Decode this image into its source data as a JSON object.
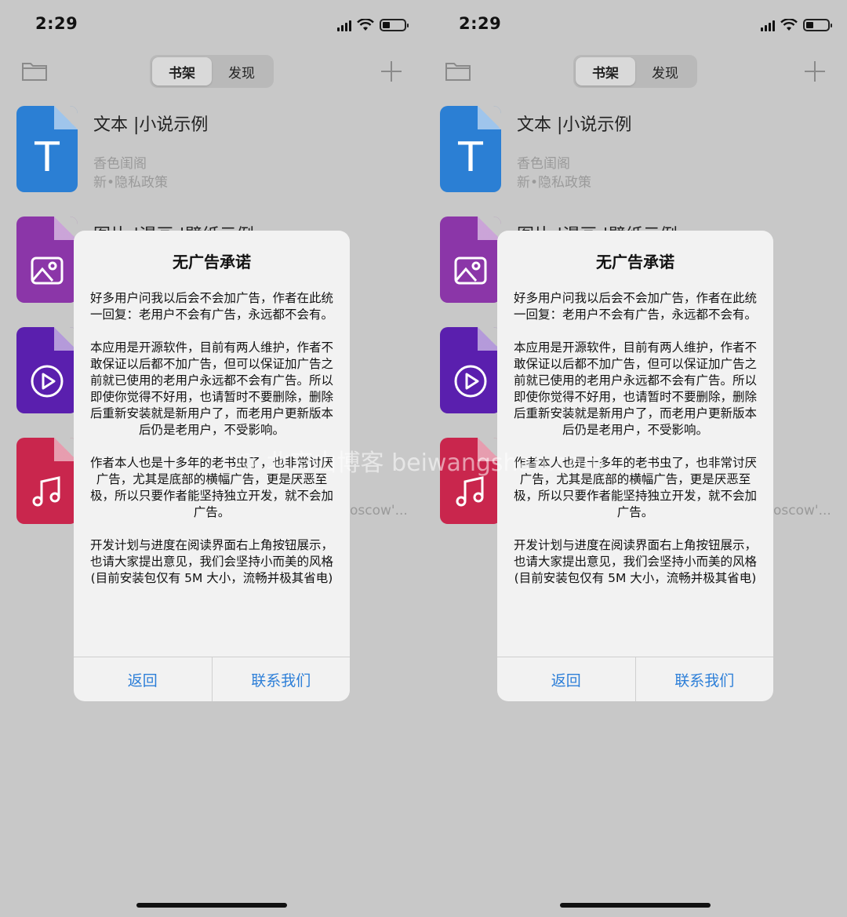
{
  "status": {
    "time": "2:29"
  },
  "nav": {
    "tabs": [
      "书架",
      "发现"
    ],
    "active_tab": "书架"
  },
  "books": {
    "text_title": "文本 |小说示例",
    "text_sub1": "香色闺阁",
    "text_sub2": "新•隐私政策",
    "image_title": "图片 |漫画 |壁纸示例",
    "truncated": "oscow'..."
  },
  "icons": {
    "text": "T",
    "image": "image-icon",
    "video": "play-icon",
    "music": "music-note-icon"
  },
  "colors": {
    "text_book": "#2b7fd4",
    "image_book": "#8b36a8",
    "video_book": "#5a1fae",
    "music_book": "#c9264d",
    "alert_button": "#2d7fd8"
  },
  "alert": {
    "title": "无广告承诺",
    "p1": "好多用户问我以后会不会加广告，作者在此统一回复：老用户不会有广告，永远都不会有。",
    "p2": "本应用是开源软件，目前有两人维护，作者不敢保证以后都不加广告，但可以保证加广告之前就已使用的老用户永远都不会有广告。所以即使你觉得不好用，也请暂时不要删除，删除后重新安装就是新用户了，而老用户更新版本后仍是老用户，不受影响。",
    "p3": "作者本人也是十多年的老书虫了，也非常讨厌广告，尤其是底部的横幅广告，更是厌恶至极，所以只要作者能坚持独立开发，就不会加广告。",
    "p4": "开发计划与进度在阅读界面右上角按钮展示，也请大家提出意见，我们会坚持小而美的风格 (目前安装包仅有 5M 大小，流畅并极其省电)",
    "back_label": "返回",
    "contact_label": "联系我们"
  },
  "watermark": "© 北忘山博客 beiwangshan.com"
}
